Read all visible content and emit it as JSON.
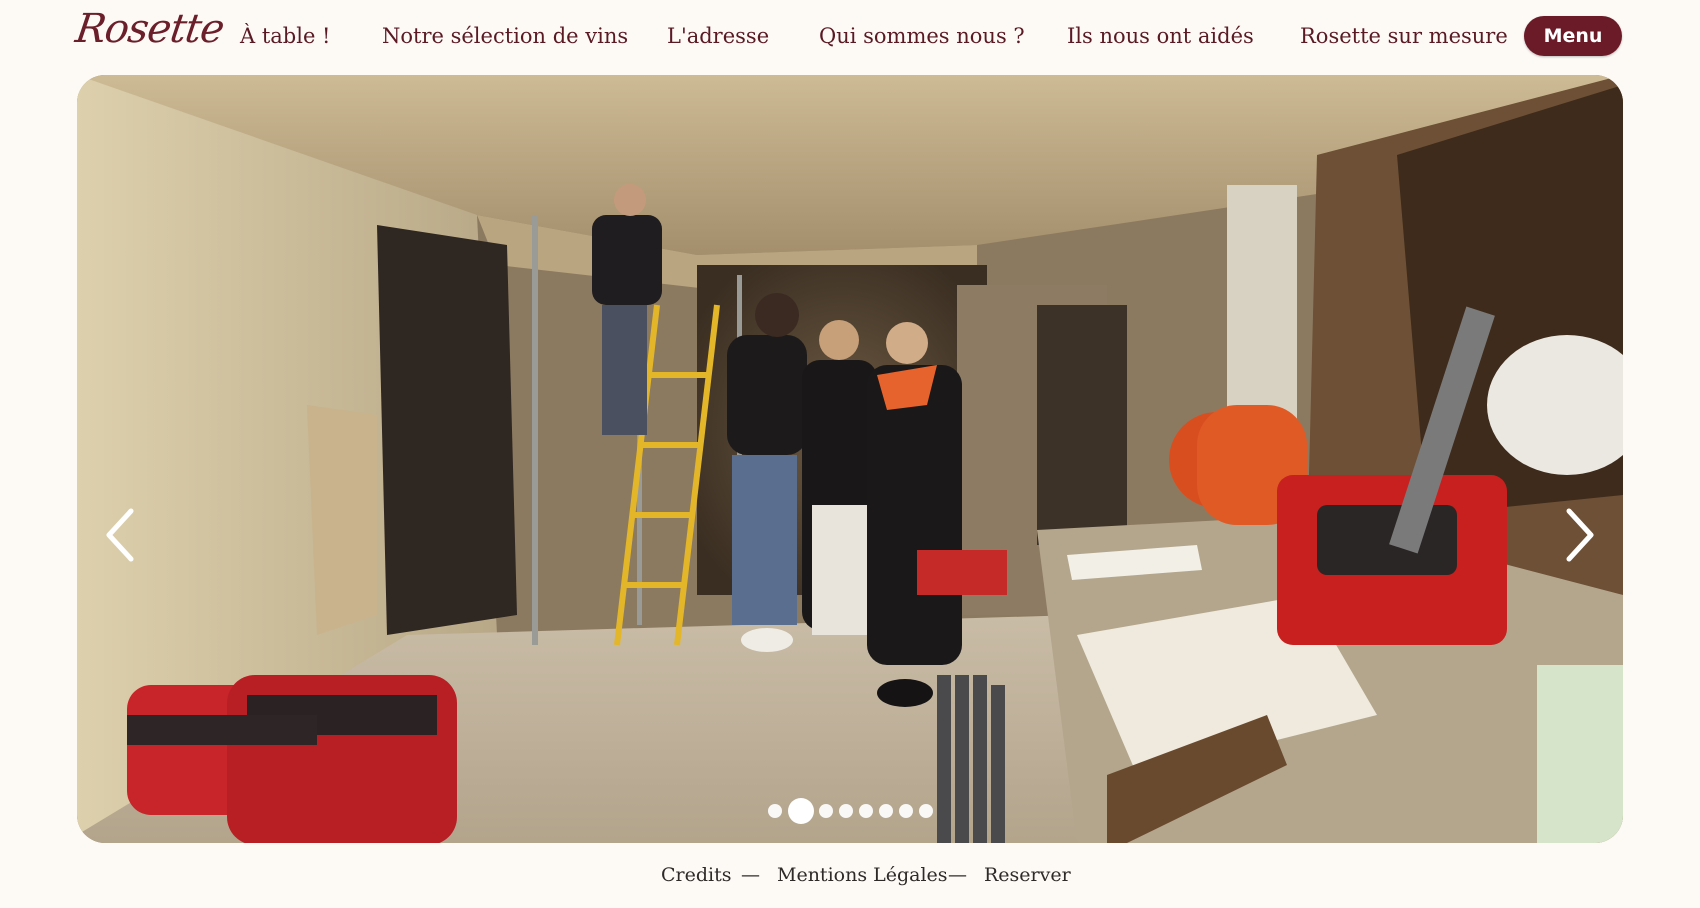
{
  "header": {
    "logo": "Rosette",
    "nav": [
      {
        "label": "À table !"
      },
      {
        "label": "Notre sélection de vins"
      },
      {
        "label": "L'adresse"
      },
      {
        "label": "Qui sommes nous ?"
      },
      {
        "label": "Ils nous ont aidés"
      },
      {
        "label": "Rosette sur mesure"
      }
    ],
    "menu_label": "Menu"
  },
  "carousel": {
    "prev_icon": "chevron-left-icon",
    "next_icon": "chevron-right-icon",
    "slide_count": 8,
    "active_slide": 2
  },
  "footer": {
    "links": [
      {
        "label": "Credits"
      },
      {
        "label": "Mentions Légales"
      },
      {
        "label": "Reserver"
      }
    ],
    "separator": "—"
  },
  "colors": {
    "brand": "#6b1a28",
    "background": "#fdfaf6",
    "text": "#2e2a28"
  }
}
